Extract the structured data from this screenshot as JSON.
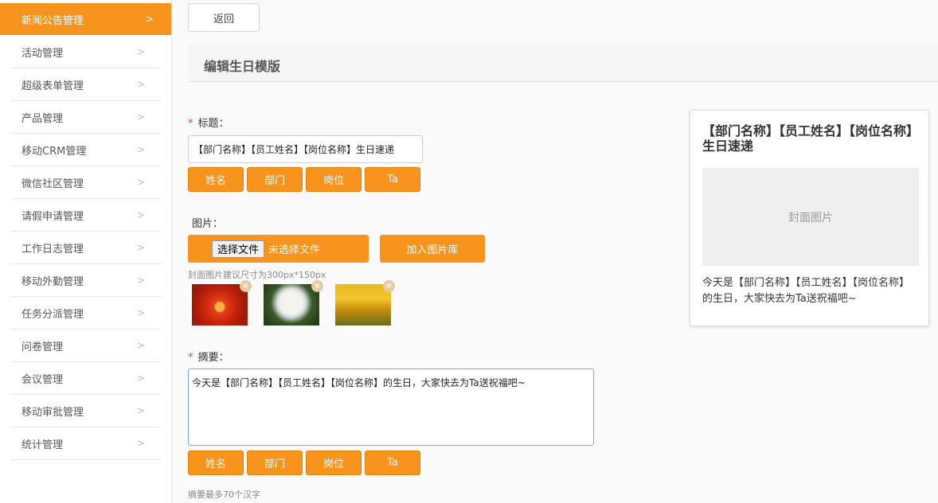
{
  "sidebar": {
    "items": [
      {
        "label": "新闻公告管理",
        "active": true
      },
      {
        "label": "活动管理"
      },
      {
        "label": "超级表单管理"
      },
      {
        "label": "产品管理"
      },
      {
        "label": "移动CRM管理"
      },
      {
        "label": "微信社区管理"
      },
      {
        "label": "请假申请管理"
      },
      {
        "label": "工作日志管理"
      },
      {
        "label": "移动外勤管理"
      },
      {
        "label": "任务分派管理"
      },
      {
        "label": "问卷管理"
      },
      {
        "label": "会议管理"
      },
      {
        "label": "移动审批管理"
      },
      {
        "label": "统计管理"
      }
    ],
    "chevron": ">"
  },
  "toolbar": {
    "back_label": "返回"
  },
  "page": {
    "title": "编辑生日模版"
  },
  "form": {
    "required_mark": "*",
    "title_label": "标题：",
    "title_value": "【部门名称】【员工姓名】【岗位名称】生日速递",
    "insert_tags": [
      "姓名",
      "部门",
      "岗位",
      "Ta"
    ],
    "image_label": "图片：",
    "file_choose_label": "选择文件",
    "file_status": "未选择文件",
    "library_button": "加入图片库",
    "image_hint": "封面图片建议尺寸为300px*150px",
    "thumbnails_remove": "×",
    "summary_label": "摘要：",
    "summary_value": "今天是【部门名称】【员工姓名】【岗位名称】的生日，大家快去为Ta送祝福吧~",
    "summary_hint": "摘要最多70个汉字"
  },
  "preview": {
    "title": "【部门名称】【员工姓名】【岗位名称】生日速递",
    "cover_placeholder": "封面图片",
    "summary": "今天是【部门名称】【员工姓名】【岗位名称】的生日，大家快去为Ta送祝福吧~"
  },
  "colors": {
    "accent": "#f7941d",
    "required": "#e4393c"
  }
}
